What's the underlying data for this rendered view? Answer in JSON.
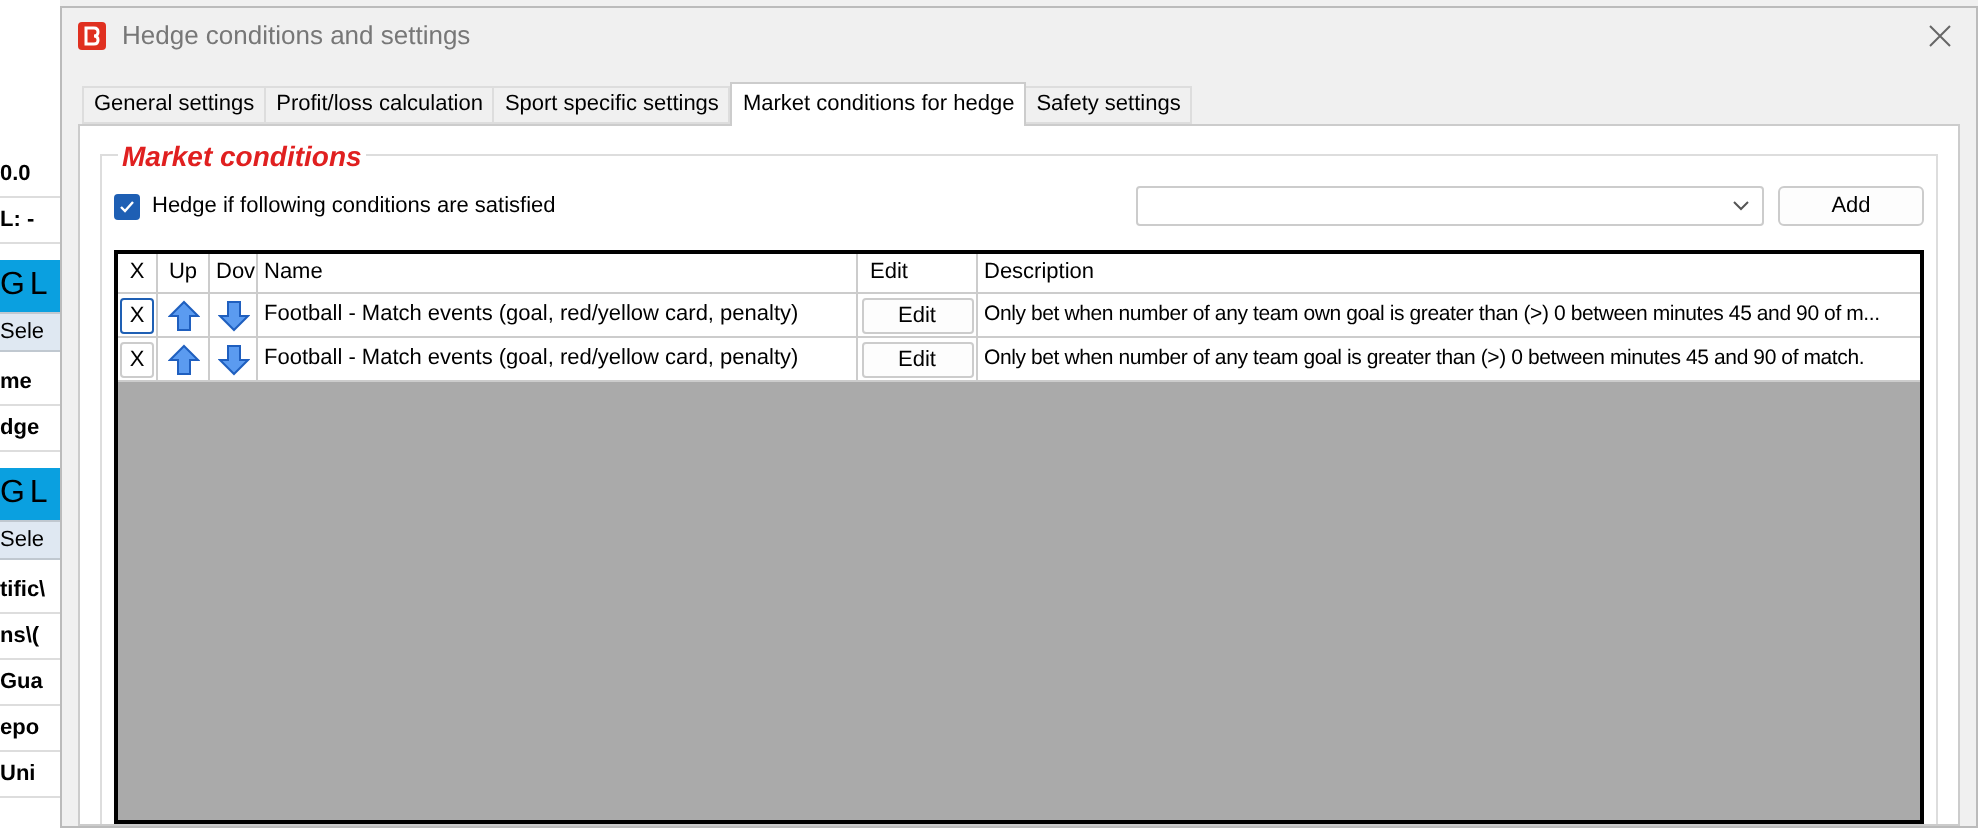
{
  "background_app": {
    "items": [
      {
        "kind": "text",
        "label": "0.0"
      },
      {
        "kind": "text",
        "label": "L: -"
      },
      {
        "kind": "banner",
        "label": "G L"
      },
      {
        "kind": "button",
        "label": "Sele"
      },
      {
        "kind": "text",
        "label": "me"
      },
      {
        "kind": "text",
        "label": "dge"
      },
      {
        "kind": "banner",
        "label": "G L"
      },
      {
        "kind": "button",
        "label": "Sele"
      },
      {
        "kind": "text",
        "label": "tific\\"
      },
      {
        "kind": "text",
        "label": "ns\\("
      },
      {
        "kind": "text",
        "label": "Gua"
      },
      {
        "kind": "text",
        "label": "epo"
      },
      {
        "kind": "text",
        "label": "Uni"
      }
    ]
  },
  "window": {
    "title": "Hedge conditions and settings"
  },
  "tabs": [
    {
      "label": "General settings",
      "selected": false
    },
    {
      "label": "Profit/loss calculation",
      "selected": false
    },
    {
      "label": "Sport specific settings",
      "selected": false
    },
    {
      "label": "Market conditions for hedge",
      "selected": true
    },
    {
      "label": "Safety settings",
      "selected": false
    }
  ],
  "group": {
    "title": "Market conditions",
    "hedge_checkbox": {
      "label": "Hedge if following conditions are satisfied",
      "checked": true
    },
    "add_button": "Add"
  },
  "table": {
    "columns": [
      "X",
      "Up",
      "Dov",
      "Name",
      "Edit",
      "Description"
    ],
    "rows": [
      {
        "remove": "X",
        "focused": true,
        "name": "Football - Match events (goal, red/yellow card, penalty)",
        "edit": "Edit",
        "description": "Only bet when number of any team own goal is greater than (>) 0 between minutes 45 and 90 of m..."
      },
      {
        "remove": "X",
        "focused": false,
        "name": "Football - Match events (goal, red/yellow card, penalty)",
        "edit": "Edit",
        "description": "Only bet when number of any team goal is greater than (>) 0 between minutes 45 and 90 of match."
      }
    ]
  }
}
